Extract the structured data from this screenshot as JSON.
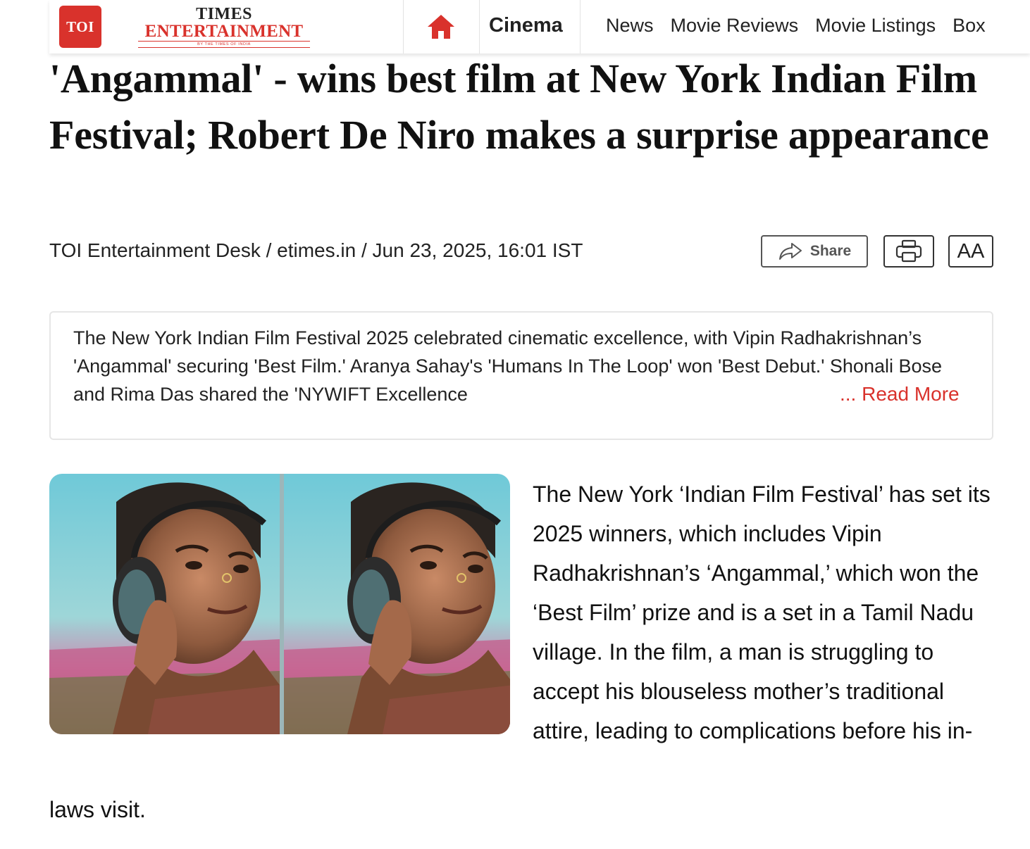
{
  "header": {
    "logo_badge": "TOI",
    "brand_top": "TIMES",
    "brand_main": "ENTERTAINMENT",
    "brand_sub": "BY THE TIMES OF INDIA",
    "home_icon": "home-icon",
    "section_active": "Cinema",
    "nav_items": [
      "News",
      "Movie Reviews",
      "Movie Listings",
      "Box"
    ]
  },
  "article": {
    "headline": "'Angammal' - wins best film at New York Indian Film Festival; Robert De Niro makes a surprise appearance",
    "byline": "TOI Entertainment Desk / etimes.in / Jun 23, 2025, 16:01 IST",
    "summary": "The New York Indian Film Festival 2025 celebrated cinematic excellence, with Vipin Radhakrishnan’s 'Angammal' securing 'Best Film.' Aranya Sahay's 'Humans In The Loop' won 'Best Debut.' Shonali Bose and Rima Das shared the 'NYWIFT Excellence",
    "read_more": "... Read More",
    "body_main": "The New York ‘Indian Film Festival’ has set its 2025 winners, which includes Vipin Radhakrishnan’s ‘Angammal,’ which won the ‘Best Film’ prize and is a set in a Tamil Nadu village. In the film, a man is struggling to accept his blouseless mother’s traditional attire, leading to complications before his in-",
    "body_continued": "laws visit."
  },
  "toolbar": {
    "share_label": "Share",
    "share_icon": "share-arrow-icon",
    "print_icon": "printer-icon",
    "font_size_label": "AA"
  },
  "colors": {
    "brand_red": "#d9322c",
    "text": "#111111",
    "border": "#e6e6e6"
  }
}
